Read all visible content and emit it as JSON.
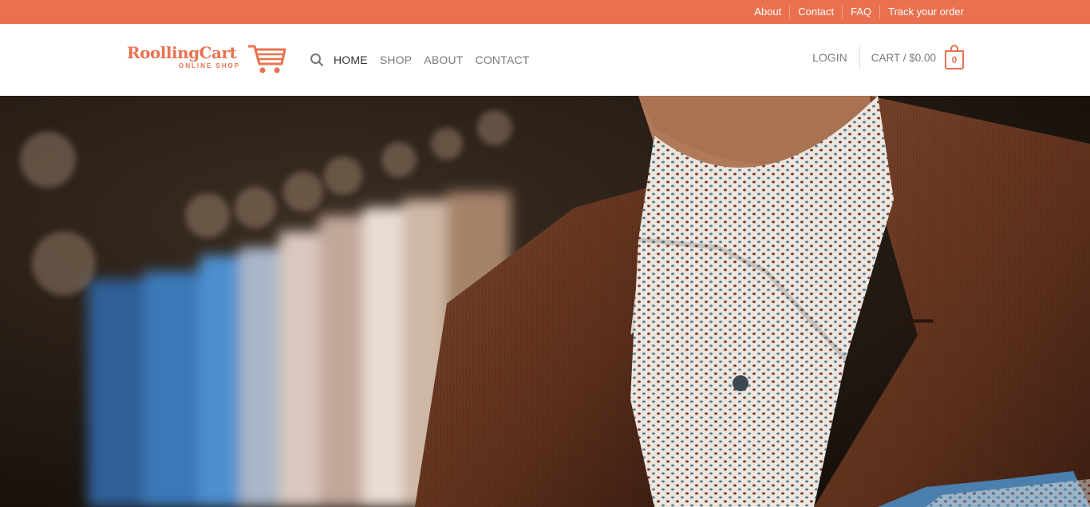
{
  "topbar": {
    "links": [
      "About",
      "Contact",
      "FAQ",
      "Track your order"
    ],
    "background": "#e9714f"
  },
  "logo": {
    "name": "RoollingCart",
    "tagline": "ONLINE SHOP",
    "color": "#e9714f"
  },
  "nav": {
    "items": [
      "HOME",
      "SHOP",
      "ABOUT",
      "CONTACT"
    ],
    "active": "HOME"
  },
  "header_right": {
    "login": "LOGIN",
    "cart_label": "CART / $0.00",
    "cart_count": "0"
  },
  "icons": {
    "search": "search-icon",
    "cart": "cart-icon",
    "bag": "shopping-bag-icon"
  },
  "hero": {
    "description_colors": {
      "jacket": "#6b3a25",
      "shirt": "#e8e4df",
      "background": "#1f160f"
    }
  }
}
